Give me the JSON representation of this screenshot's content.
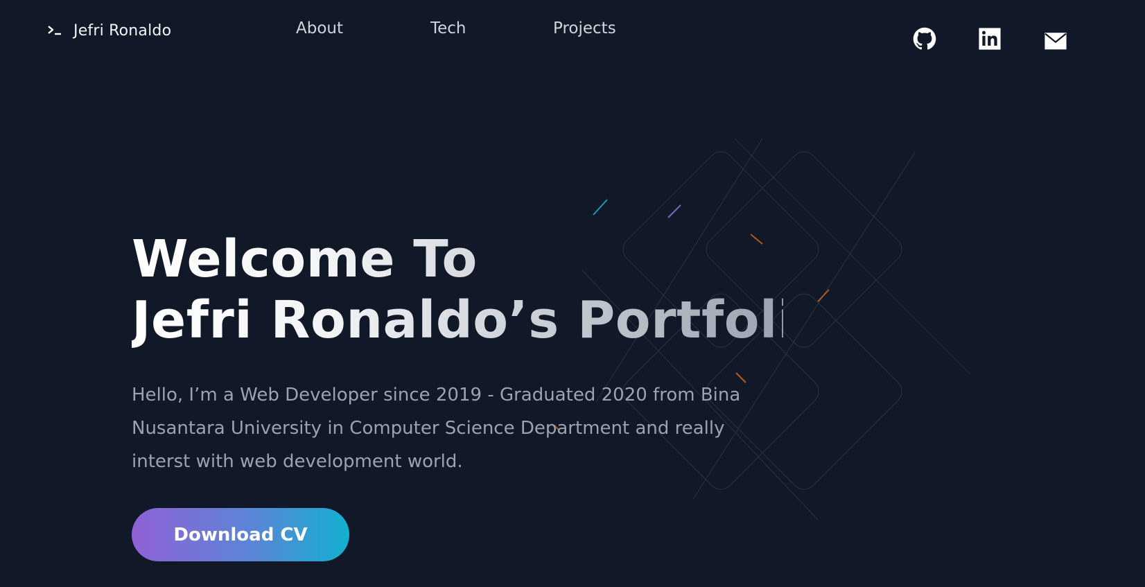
{
  "header": {
    "brand": "Jefri Ronaldo",
    "nav": [
      {
        "label": "About"
      },
      {
        "label": "Tech"
      },
      {
        "label": "Projects"
      }
    ],
    "social": [
      {
        "icon": "github-icon"
      },
      {
        "icon": "linkedin-icon"
      },
      {
        "icon": "mail-icon"
      }
    ]
  },
  "hero": {
    "title_line1": "Welcome To",
    "title_line2": "Jefri Ronaldo’s Portfolio",
    "description": "Hello, I’m a Web Developer since 2019 - Graduated 2020 from Bina Nusantara University in Computer Science Department and really interst with web development world.",
    "cta_label": "Download CV"
  },
  "colors": {
    "background": "#111827",
    "cta_gradient_start": "#9061d6",
    "cta_gradient_end": "#12b0cf"
  }
}
